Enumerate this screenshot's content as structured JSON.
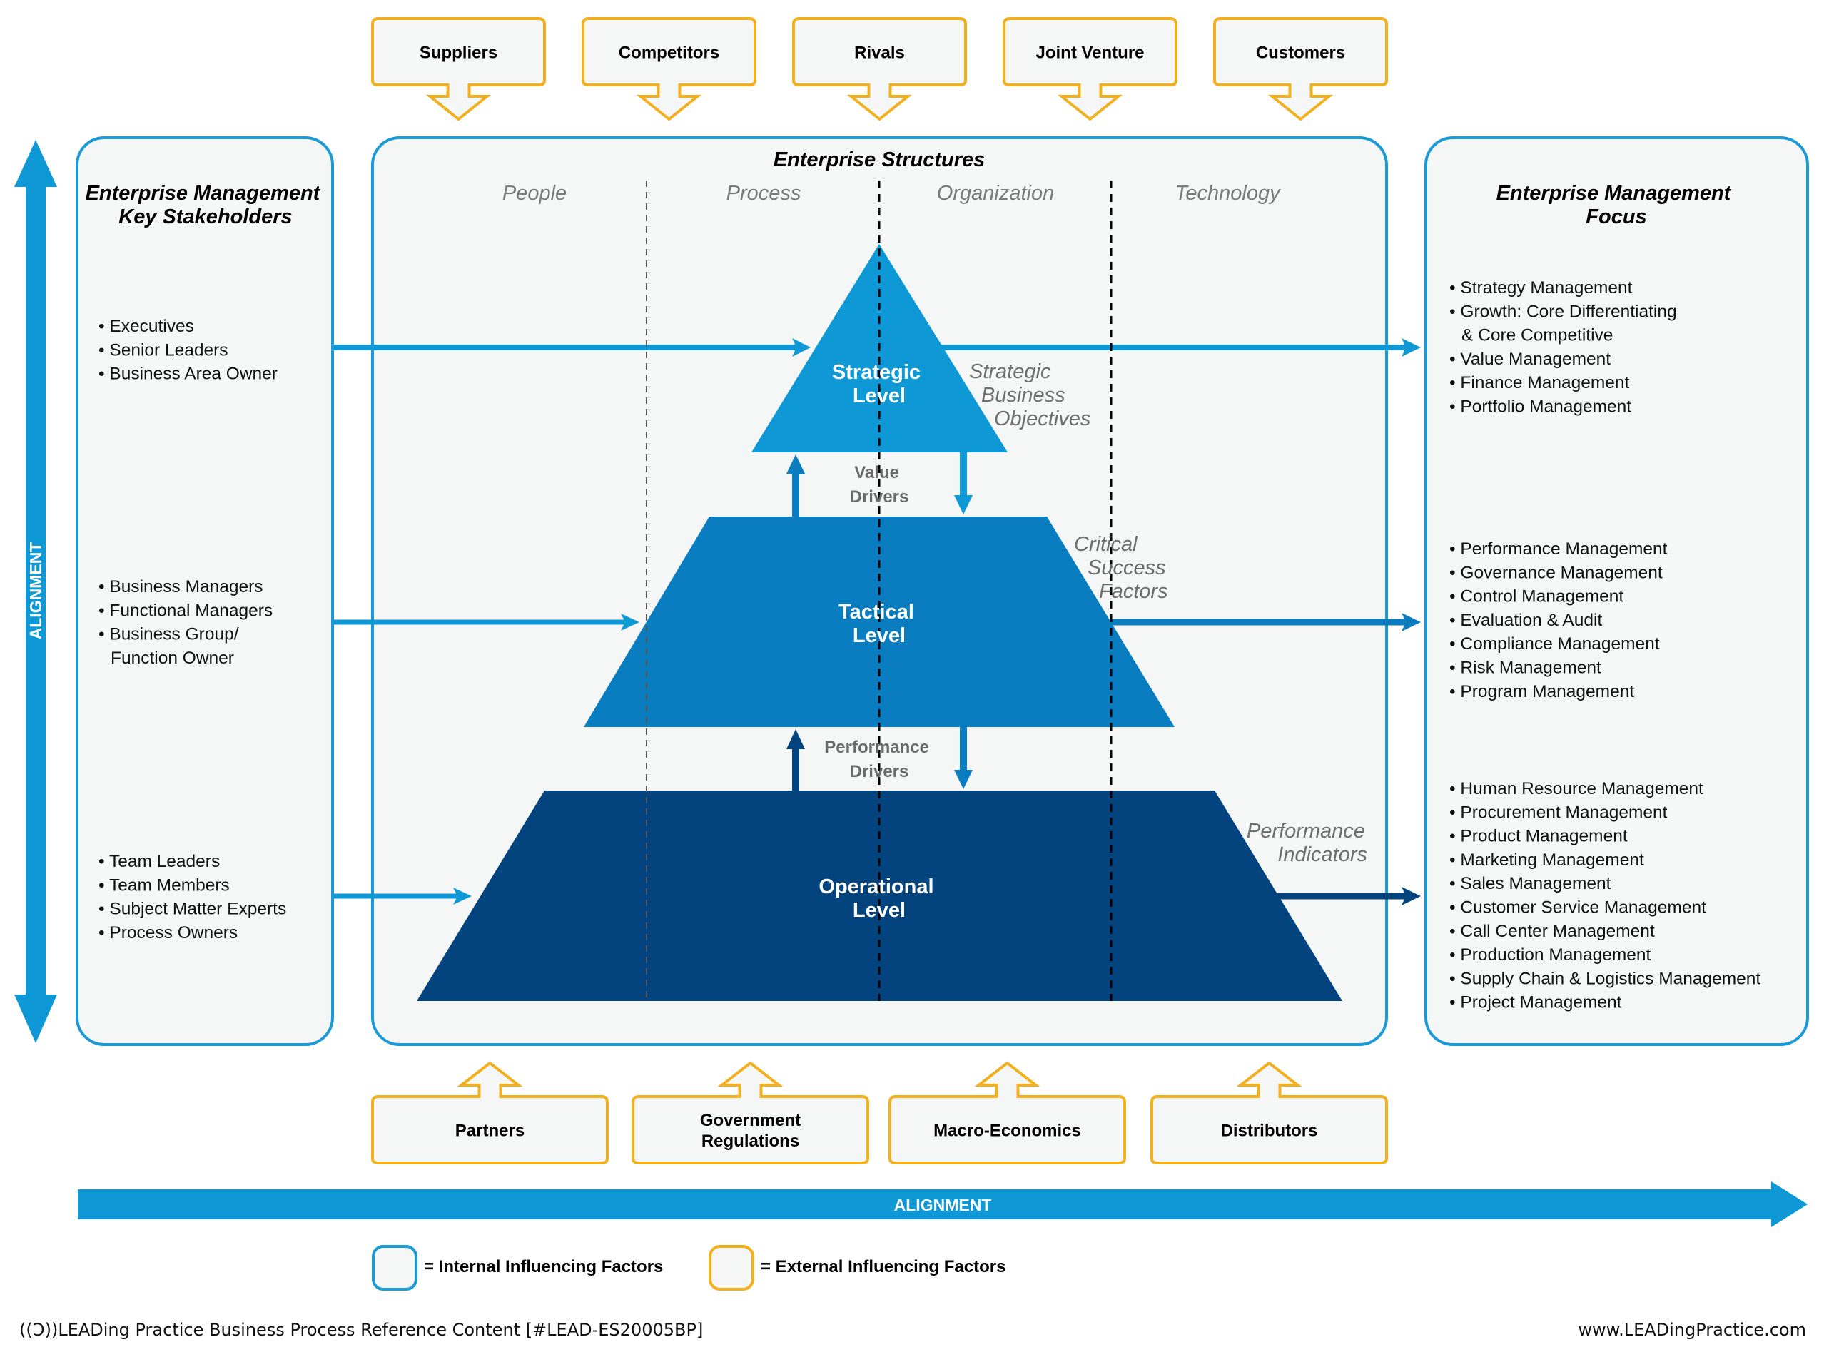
{
  "colors": {
    "internal_border": "#1a9ad6",
    "external_border": "#f2b01e",
    "panel_fill": "#f5f6f6",
    "alignment_arrow": "#0e98d5",
    "strategic": "#0e98d5",
    "tactical": "#0a7dc1",
    "operational": "#03437e"
  },
  "external_top": [
    {
      "label": "Suppliers"
    },
    {
      "label": "Competitors"
    },
    {
      "label": "Rivals"
    },
    {
      "label": "Joint Venture"
    },
    {
      "label": "Customers"
    }
  ],
  "external_bottom": [
    {
      "lines": [
        "Partners"
      ]
    },
    {
      "lines": [
        "Government",
        "Regulations"
      ]
    },
    {
      "lines": [
        "Macro-Economics"
      ]
    },
    {
      "lines": [
        "Distributors"
      ]
    }
  ],
  "left_panel": {
    "title_lines": [
      "Enterprise Management",
      "Key Stakeholders"
    ],
    "groups": [
      [
        "• Executives",
        "• Senior Leaders",
        "• Business Area Owner"
      ],
      [
        "• Business Managers",
        "• Functional Managers",
        "• Business Group/",
        "  Function Owner"
      ],
      [
        "• Team Leaders",
        "• Team Members",
        "• Subject Matter Experts",
        "• Process Owners"
      ]
    ]
  },
  "center_panel": {
    "title": "Enterprise Structures",
    "columns": [
      "People",
      "Process",
      "Organization",
      "Technology"
    ],
    "levels": [
      {
        "lines": [
          "Strategic",
          "Level"
        ]
      },
      {
        "lines": [
          "Tactical",
          "Level"
        ]
      },
      {
        "lines": [
          "Operational",
          "Level"
        ]
      }
    ],
    "drivers": [
      {
        "lines": [
          "Value",
          "Drivers"
        ]
      },
      {
        "lines": [
          "Performance",
          "Drivers"
        ]
      }
    ],
    "side_notes": [
      {
        "lines": [
          "Strategic",
          "Business",
          "Objectives"
        ]
      },
      {
        "lines": [
          "Critical",
          "Success",
          "Factors"
        ]
      },
      {
        "lines": [
          "Performance",
          "Indicators"
        ]
      }
    ]
  },
  "right_panel": {
    "title_lines": [
      "Enterprise Management",
      "Focus"
    ],
    "groups": [
      [
        "• Strategy Management",
        "• Growth: Core Differentiating",
        "  & Core Competitive",
        "• Value Management",
        "• Finance Management",
        "• Portfolio Management"
      ],
      [
        "• Performance Management",
        "• Governance Management",
        "• Control Management",
        "• Evaluation & Audit",
        "• Compliance Management",
        "• Risk Management",
        "• Program Management"
      ],
      [
        "• Human Resource Management",
        "• Procurement Management",
        "• Product Management",
        "• Marketing Management",
        "• Sales Management",
        "• Customer Service Management",
        "• Call Center Management",
        "• Production Management",
        "• Supply Chain & Logistics Management",
        "• Project Management"
      ]
    ]
  },
  "alignment": {
    "vertical_label": "ALIGNMENT",
    "horizontal_label": "ALIGNMENT"
  },
  "legend": {
    "internal": "= Internal Influencing Factors",
    "external": "= External Influencing Factors"
  },
  "footer": {
    "logo": "((Ɔ))LEADing",
    "left_text": " Practice Business Process Reference Content [#LEAD-ES20005BP]",
    "right_text": "www.LEADingPractice.com"
  }
}
